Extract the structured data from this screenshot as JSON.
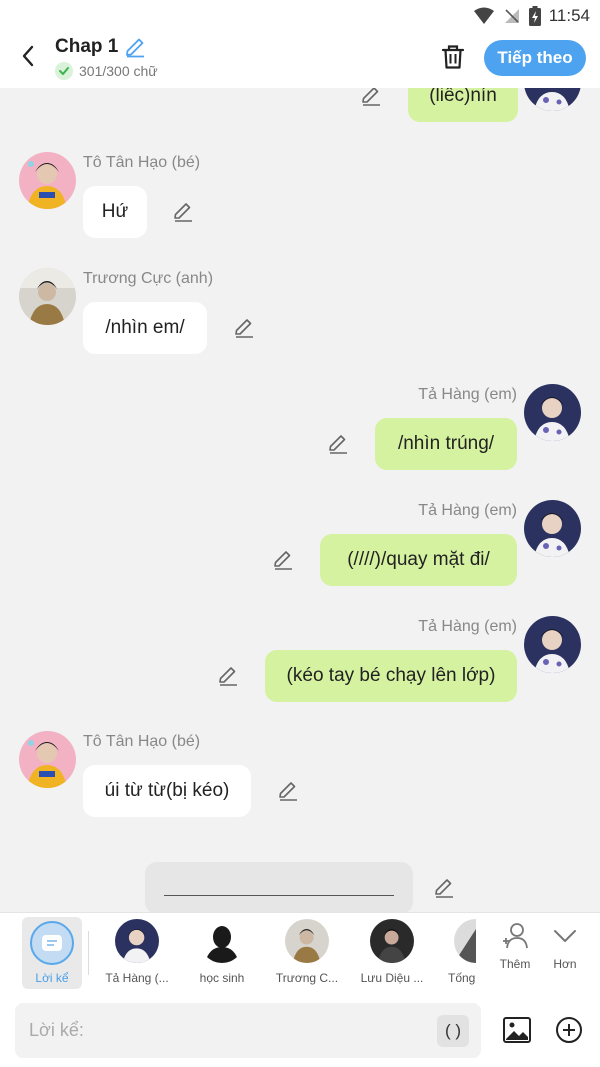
{
  "status": {
    "time": "11:54"
  },
  "header": {
    "title": "Chap 1",
    "word_count": "301/300 chữ",
    "next_label": "Tiếp theo"
  },
  "messages": [
    {
      "side": "right",
      "sender": "",
      "text": "(liếc)nín"
    },
    {
      "side": "left",
      "sender": "Tô Tân Hạo (bé)",
      "text": "Hứ"
    },
    {
      "side": "left",
      "sender": "Trương Cực (anh)",
      "text": "/nhìn em/"
    },
    {
      "side": "right",
      "sender": "Tả Hàng (em)",
      "text": "/nhìn trúng/"
    },
    {
      "side": "right",
      "sender": "Tả Hàng (em)",
      "text": "(////)/quay mặt đi/"
    },
    {
      "side": "right",
      "sender": "Tả Hàng (em)",
      "text": "(kéo tay bé chạy lên lớp)"
    },
    {
      "side": "left",
      "sender": "Tô Tân Hạo (bé)",
      "text": "úi từ từ(bị kéo)"
    }
  ],
  "characters": {
    "narrator_label": "Lời kể",
    "items": [
      "Tả Hàng (...",
      "học sinh",
      "Trương C...",
      "Lưu Diệu ...",
      "Tống"
    ],
    "more_label": "Thêm",
    "expand_label": "Hơn"
  },
  "input": {
    "placeholder": "Lời kể:",
    "paren_label": "( )"
  },
  "colors": {
    "accent": "#4da3f0",
    "right_bubble": "#d5f2a0",
    "left_bubble": "#ffffff",
    "background": "#f2f2f2"
  }
}
